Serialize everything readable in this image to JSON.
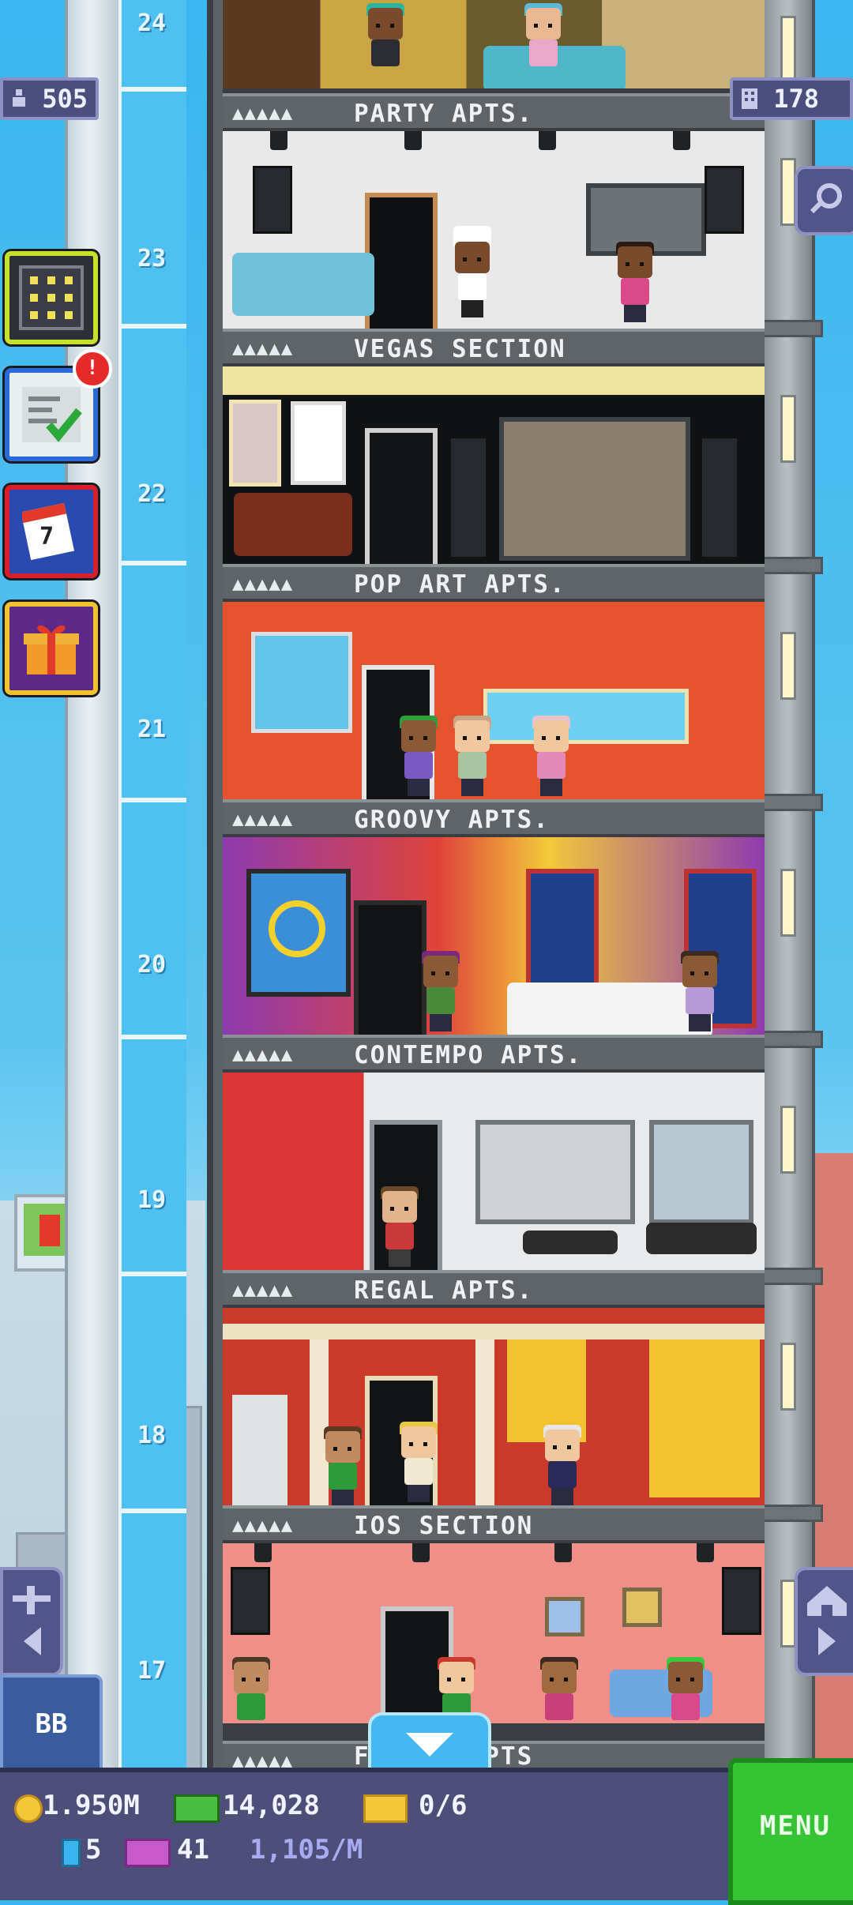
{
  "top_bar": {
    "population": "505",
    "floors": "178",
    "population_icon": "person-icon",
    "floors_icon": "building-icon",
    "search_icon": "magnifier-icon"
  },
  "floor_numbers": [
    "24",
    "23",
    "22",
    "21",
    "20",
    "19",
    "18",
    "17"
  ],
  "floors": [
    {
      "label": "PARTY APTS.",
      "dots": "▲▲▲▲▲"
    },
    {
      "label": "VEGAS SECTION",
      "dots": "▲▲▲▲▲"
    },
    {
      "label": "POP ART APTS.",
      "dots": "▲▲▲▲▲"
    },
    {
      "label": "GROOVY APTS.",
      "dots": "▲▲▲▲▲"
    },
    {
      "label": "CONTEMPO APTS.",
      "dots": "▲▲▲▲▲"
    },
    {
      "label": "REGAL APTS.",
      "dots": "▲▲▲▲▲"
    },
    {
      "label": "IOS SECTION",
      "dots": "▲▲▲▲▲"
    },
    {
      "label": "F… …KE APTS",
      "dots": "▲▲▲▲▲"
    }
  ],
  "side_buttons": [
    {
      "name": "elevator-panel",
      "icon": "keypad-icon"
    },
    {
      "name": "missions",
      "icon": "checklist-icon",
      "notification": "!"
    },
    {
      "name": "calendar",
      "icon": "calendar-icon",
      "day": "7"
    },
    {
      "name": "gift",
      "icon": "gift-icon"
    }
  ],
  "bottom_left": {
    "bb_label": "BB",
    "vip_icon": "plane-icon"
  },
  "bottom_right": {
    "home_icon": "house-icon"
  },
  "hud": {
    "coins": "1.950M",
    "cash": "14,028",
    "tickets": "0/6",
    "bitizens_stat": "5",
    "bux_stat": "41",
    "rate": "1,105/M",
    "menu_label": "MENU"
  },
  "colors": {
    "sky": "#3ab4ec",
    "hud_bg": "#4d4f78",
    "menu_green": "#35c534",
    "banner_bg": "#5f6468"
  }
}
